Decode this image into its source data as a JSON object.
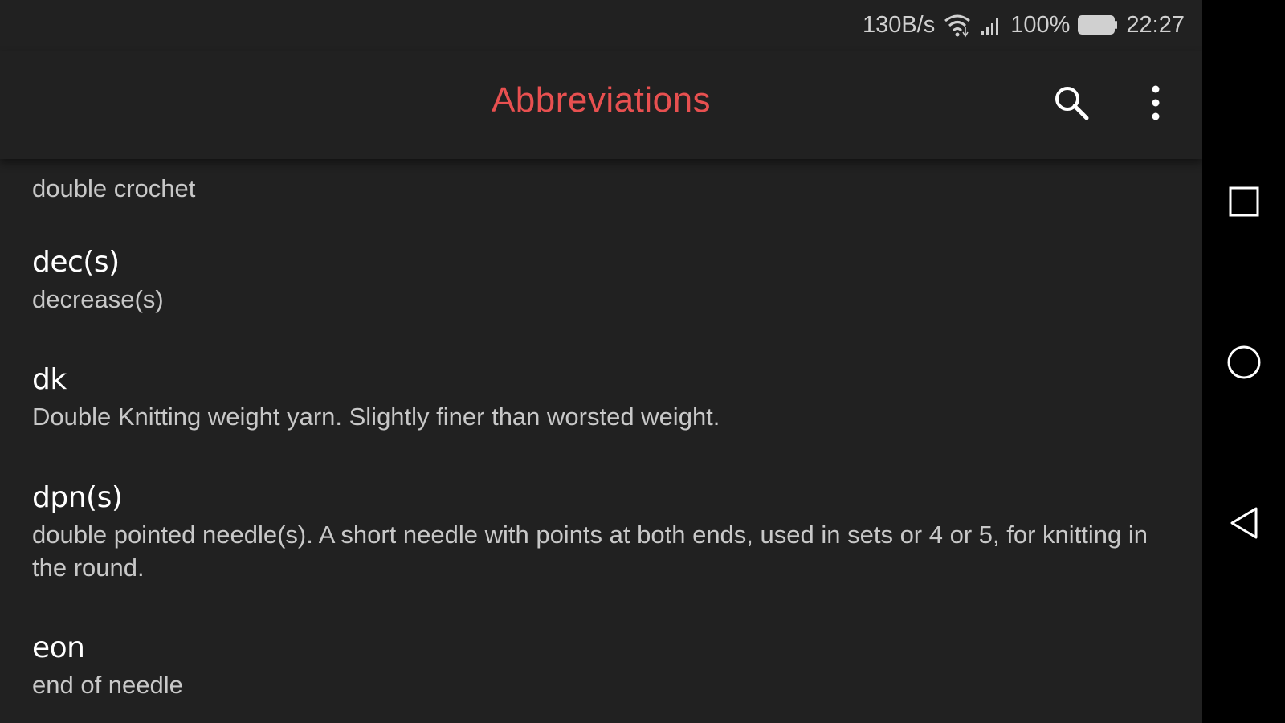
{
  "status_bar": {
    "network_speed": "130B/s",
    "battery_percent": "100%",
    "time": "22:27",
    "icons": [
      "wifi-icon",
      "cellular-signal-icon",
      "battery-icon"
    ]
  },
  "app_bar": {
    "title": "Abbreviations",
    "title_color": "#e85050",
    "actions": [
      "search-icon",
      "more-options-icon"
    ]
  },
  "abbreviations": [
    {
      "term": "",
      "definition": "double crochet"
    },
    {
      "term": "dec(s)",
      "definition": "decrease(s)"
    },
    {
      "term": "dk",
      "definition": "Double Knitting weight yarn. Slightly finer than worsted weight."
    },
    {
      "term": "dpn(s)",
      "definition": "double pointed needle(s). A short needle with points at both ends, used in sets or 4 or 5, for knitting in the round."
    },
    {
      "term": "eon",
      "definition": "end of needle"
    }
  ],
  "navigation_bar": {
    "buttons": [
      "recent-apps-icon",
      "home-icon",
      "back-icon"
    ]
  }
}
